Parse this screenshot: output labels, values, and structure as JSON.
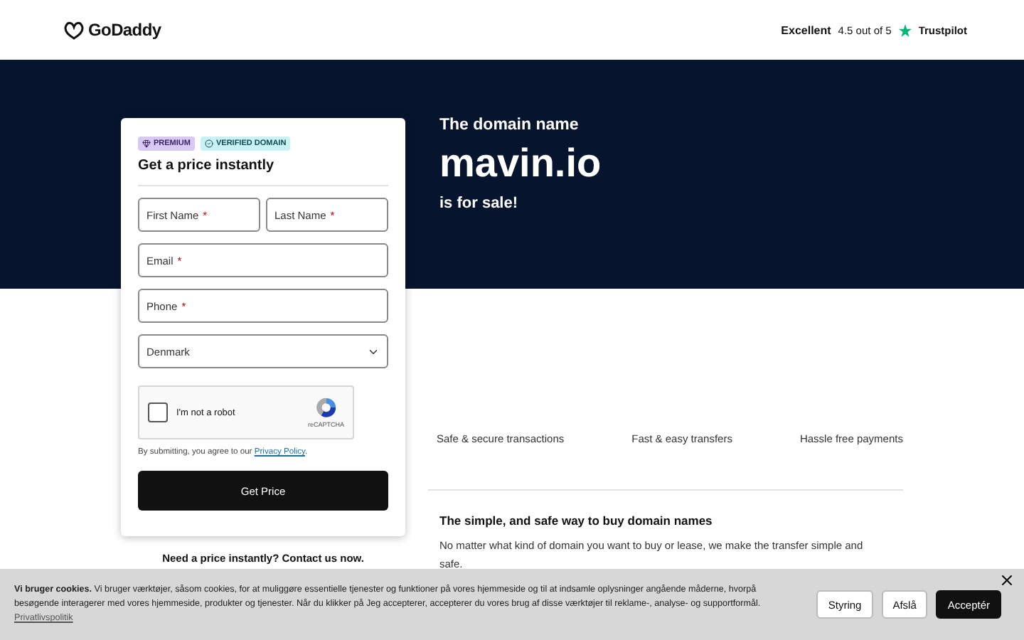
{
  "header": {
    "logo": "GoDaddy",
    "rating": {
      "label": "Excellent",
      "score": "4.5 out of 5",
      "brand": "Trustpilot"
    }
  },
  "card": {
    "badges": [
      {
        "label": "PREMIUM",
        "kind": "premium"
      },
      {
        "label": "VERIFIED DOMAIN",
        "kind": "verified"
      }
    ],
    "title": "Get a price instantly",
    "fields": [
      {
        "label": "First Name",
        "mark": "*"
      },
      {
        "label": "Last Name",
        "mark": "*"
      },
      {
        "label": "Email",
        "mark": "*"
      },
      {
        "label": "Phone",
        "mark": "*"
      }
    ],
    "country": {
      "value": "Denmark"
    },
    "captcha": {
      "label": "I'm not a robot",
      "brand": "reCAPTCHA",
      "checked": false
    },
    "consent": {
      "text": "By submitting, you agree to our",
      "link": "Privacy Policy",
      "end": "."
    },
    "button": "Get Price"
  },
  "contact": "Need a price instantly? Contact us now.",
  "hero": {
    "intro": "The domain name",
    "domain": "mavin.io",
    "outro": "is for sale!"
  },
  "features": [
    "Safe & secure transactions",
    "Fast & easy transfers",
    "Hassle free payments"
  ],
  "info": {
    "title": "The simple, and safe way to buy domain names",
    "text": "No matter what kind of domain you want to buy or lease, we make the transfer simple and safe."
  },
  "cookie_banner": {
    "text": "**Vi bruger cookies.** Vi bruger værktøjer, såsom cookies, for at muliggøre essentielle tjenester og funktioner på vores hjemmeside og til at indsamle oplysninger angående måderne, hvorpå besøgende interagerer med vores hjemmeside, produkter og tjenester. Når du klikker på Jeg accepterer, accepterer du vores brug af disse værktøjer til reklame-, analyse- og supportformål.",
    "link": "Privatlivspolitik",
    "buttons": [
      {
        "label": "Styring",
        "kind": "secondary"
      },
      {
        "label": "Afslå",
        "kind": "secondary"
      },
      {
        "label": "Acceptér",
        "kind": "primary"
      }
    ]
  }
}
